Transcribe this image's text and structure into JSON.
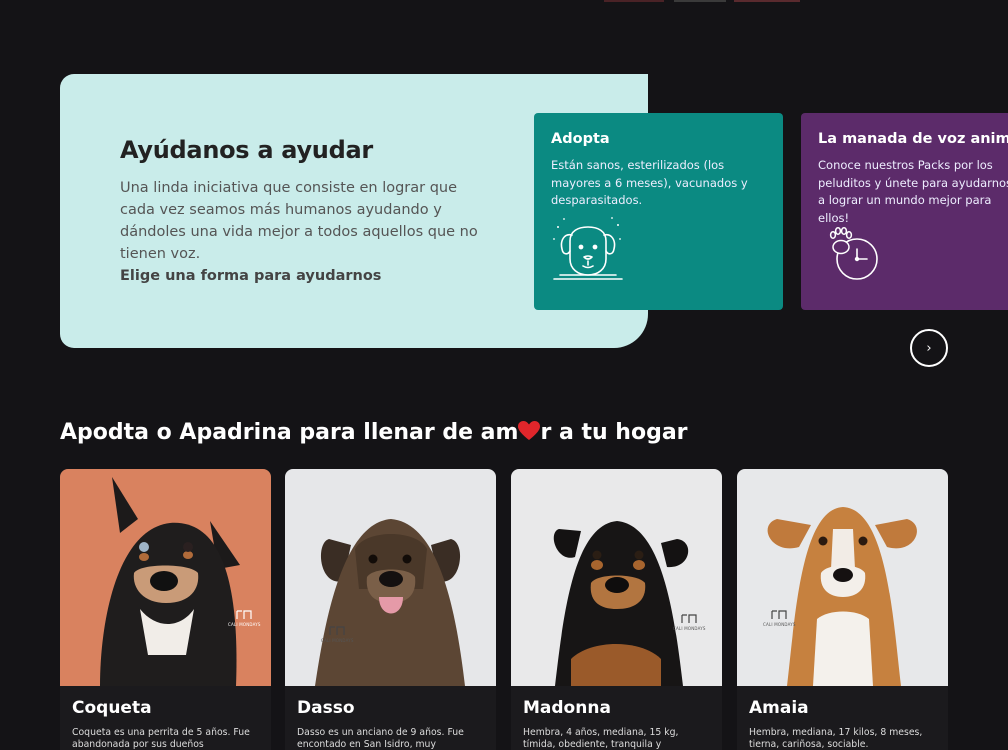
{
  "colors": {
    "background": "#141316",
    "help_card": "#c9ecea",
    "adopta": "#0b8a82",
    "manada": "#5c2b6a",
    "heart": "#e0262b"
  },
  "help": {
    "title": "Ayúdanos a ayudar",
    "description": "Una linda iniciativa que consiste en lograr que cada vez seamos más humanos ayudando y dándoles una vida mejor a todos aquellos que no tienen voz.",
    "cta": "Elige una forma para ayudarnos"
  },
  "options": [
    {
      "title": "Adopta",
      "text": "Están sanos, esterilizados (los mayores a 6 meses), vacunados y desparasitados.",
      "icon": "dog-face-icon"
    },
    {
      "title": "La manada de voz animal",
      "text": "Conoce nuestros Packs por los peluditos y únete para ayudarnos a lograr un mundo mejor para ellos!",
      "icon": "paw-clock-icon"
    }
  ],
  "carousel": {
    "next_icon": "›"
  },
  "section": {
    "title_bold": "Apodta o Apadrina",
    "title_pre": " para llenar de am",
    "title_post": "r a tu hogar"
  },
  "watermark": "CALI MONDAYS",
  "pets": [
    {
      "name": "Coqueta",
      "description": "Coqueta es una perrita de 5 años. Fue abandonada por sus dueños"
    },
    {
      "name": "Dasso",
      "description": "Dasso es un anciano de 9 años. Fue encontado en San Isidro, muy"
    },
    {
      "name": "Madonna",
      "description": "Hembra, 4 años, mediana, 15 kg, tímida, obediente, tranquila y"
    },
    {
      "name": "Amaia",
      "description": "Hembra, mediana, 17 kilos, 8 meses, tierna, cariñosa, sociable."
    }
  ]
}
